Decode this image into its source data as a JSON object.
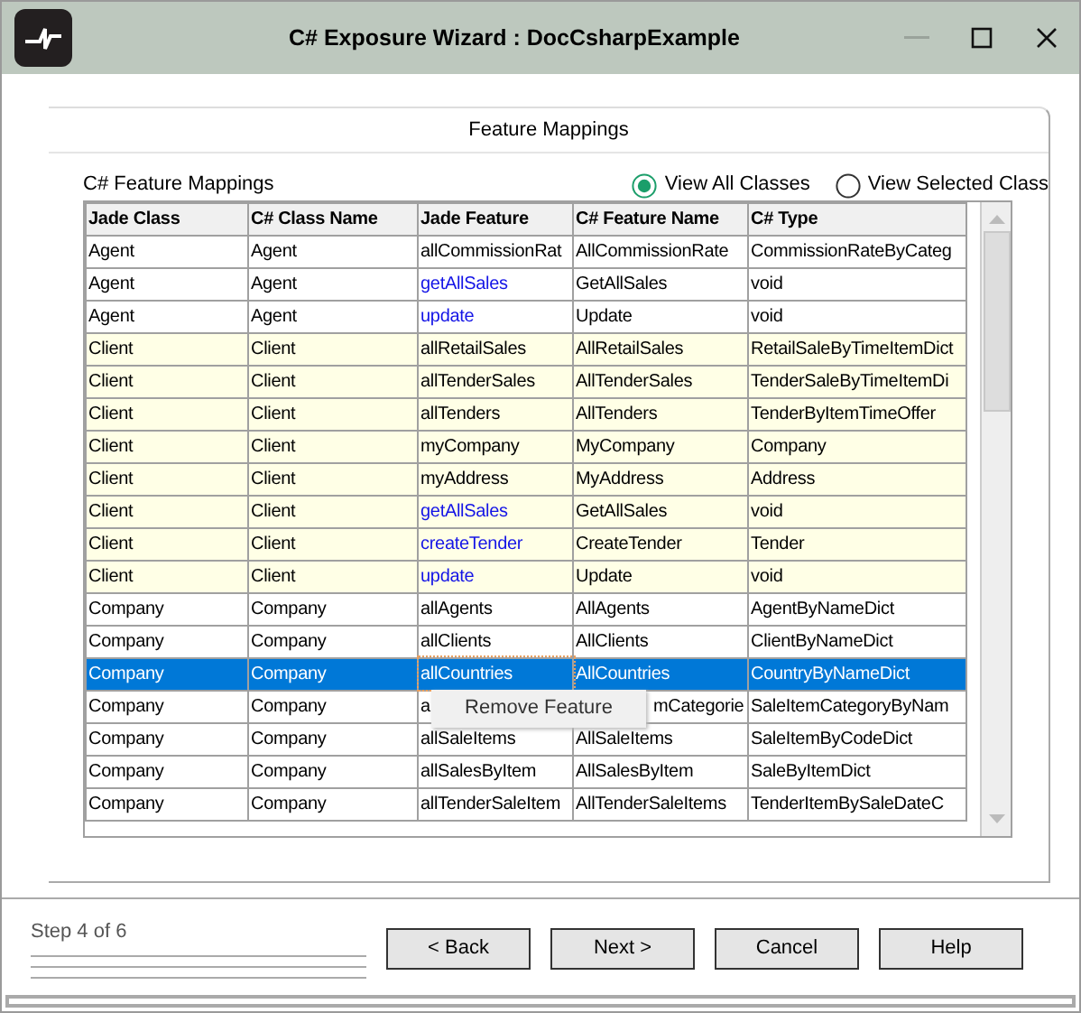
{
  "window": {
    "title": "C# Exposure Wizard : DocCsharpExample",
    "controls": [
      {
        "kind": "minimize",
        "disabled": true
      },
      {
        "kind": "maximize",
        "disabled": false
      },
      {
        "kind": "close",
        "disabled": false
      }
    ]
  },
  "panel": {
    "title": "Feature Mappings",
    "table_label": "C# Feature Mappings",
    "view_options": [
      {
        "label": "View All Classes",
        "selected": true
      },
      {
        "label": "View Selected Class",
        "selected": false
      }
    ],
    "table": {
      "columns": [
        "Jade Class",
        "C# Class Name",
        "Jade Feature",
        "C# Feature Name",
        "C# Type"
      ],
      "rows": [
        {
          "cells": [
            "Agent",
            "Agent",
            "allCommissionRat",
            "AllCommissionRate",
            "CommissionRateByCateg"
          ],
          "is_method": false,
          "shaded": false,
          "selected": false
        },
        {
          "cells": [
            "Agent",
            "Agent",
            "getAllSales",
            "GetAllSales",
            "void"
          ],
          "is_method": true,
          "shaded": false,
          "selected": false
        },
        {
          "cells": [
            "Agent",
            "Agent",
            "update",
            "Update",
            "void"
          ],
          "is_method": true,
          "shaded": false,
          "selected": false
        },
        {
          "cells": [
            "Client",
            "Client",
            "allRetailSales",
            "AllRetailSales",
            "RetailSaleByTimeItemDict"
          ],
          "is_method": false,
          "shaded": true,
          "selected": false
        },
        {
          "cells": [
            "Client",
            "Client",
            "allTenderSales",
            "AllTenderSales",
            "TenderSaleByTimeItemDi"
          ],
          "is_method": false,
          "shaded": true,
          "selected": false
        },
        {
          "cells": [
            "Client",
            "Client",
            "allTenders",
            "AllTenders",
            "TenderByItemTimeOffer"
          ],
          "is_method": false,
          "shaded": true,
          "selected": false
        },
        {
          "cells": [
            "Client",
            "Client",
            "myCompany",
            "MyCompany",
            "Company"
          ],
          "is_method": false,
          "shaded": true,
          "selected": false
        },
        {
          "cells": [
            "Client",
            "Client",
            "myAddress",
            "MyAddress",
            "Address"
          ],
          "is_method": false,
          "shaded": true,
          "selected": false
        },
        {
          "cells": [
            "Client",
            "Client",
            "getAllSales",
            "GetAllSales",
            "void"
          ],
          "is_method": true,
          "shaded": true,
          "selected": false
        },
        {
          "cells": [
            "Client",
            "Client",
            "createTender",
            "CreateTender",
            "Tender"
          ],
          "is_method": true,
          "shaded": true,
          "selected": false
        },
        {
          "cells": [
            "Client",
            "Client",
            "update",
            "Update",
            "void"
          ],
          "is_method": true,
          "shaded": true,
          "selected": false
        },
        {
          "cells": [
            "Company",
            "Company",
            "allAgents",
            "AllAgents",
            "AgentByNameDict"
          ],
          "is_method": false,
          "shaded": false,
          "selected": false
        },
        {
          "cells": [
            "Company",
            "Company",
            "allClients",
            "AllClients",
            "ClientByNameDict"
          ],
          "is_method": false,
          "shaded": false,
          "selected": false
        },
        {
          "cells": [
            "Company",
            "Company",
            "allCountries",
            "AllCountries",
            "CountryByNameDict"
          ],
          "is_method": false,
          "shaded": false,
          "selected": true
        },
        {
          "cells": [
            "Company",
            "Company",
            "a",
            "mCategorie",
            "SaleItemCategoryByNam"
          ],
          "is_method": false,
          "shaded": false,
          "selected": false,
          "covered": true
        },
        {
          "cells": [
            "Company",
            "Company",
            "allSaleItems",
            "AllSaleItems",
            "SaleItemByCodeDict"
          ],
          "is_method": false,
          "shaded": false,
          "selected": false
        },
        {
          "cells": [
            "Company",
            "Company",
            "allSalesByItem",
            "AllSalesByItem",
            "SaleByItemDict"
          ],
          "is_method": false,
          "shaded": false,
          "selected": false
        },
        {
          "cells": [
            "Company",
            "Company",
            "allTenderSaleItem",
            "AllTenderSaleItems",
            "TenderItemBySaleDateC"
          ],
          "is_method": false,
          "shaded": false,
          "selected": false
        }
      ]
    },
    "context_menu": {
      "items": [
        "Remove Feature"
      ]
    }
  },
  "footer": {
    "step": "Step 4 of 6",
    "buttons": [
      "< Back",
      "Next >",
      "Cancel",
      "Help"
    ]
  }
}
